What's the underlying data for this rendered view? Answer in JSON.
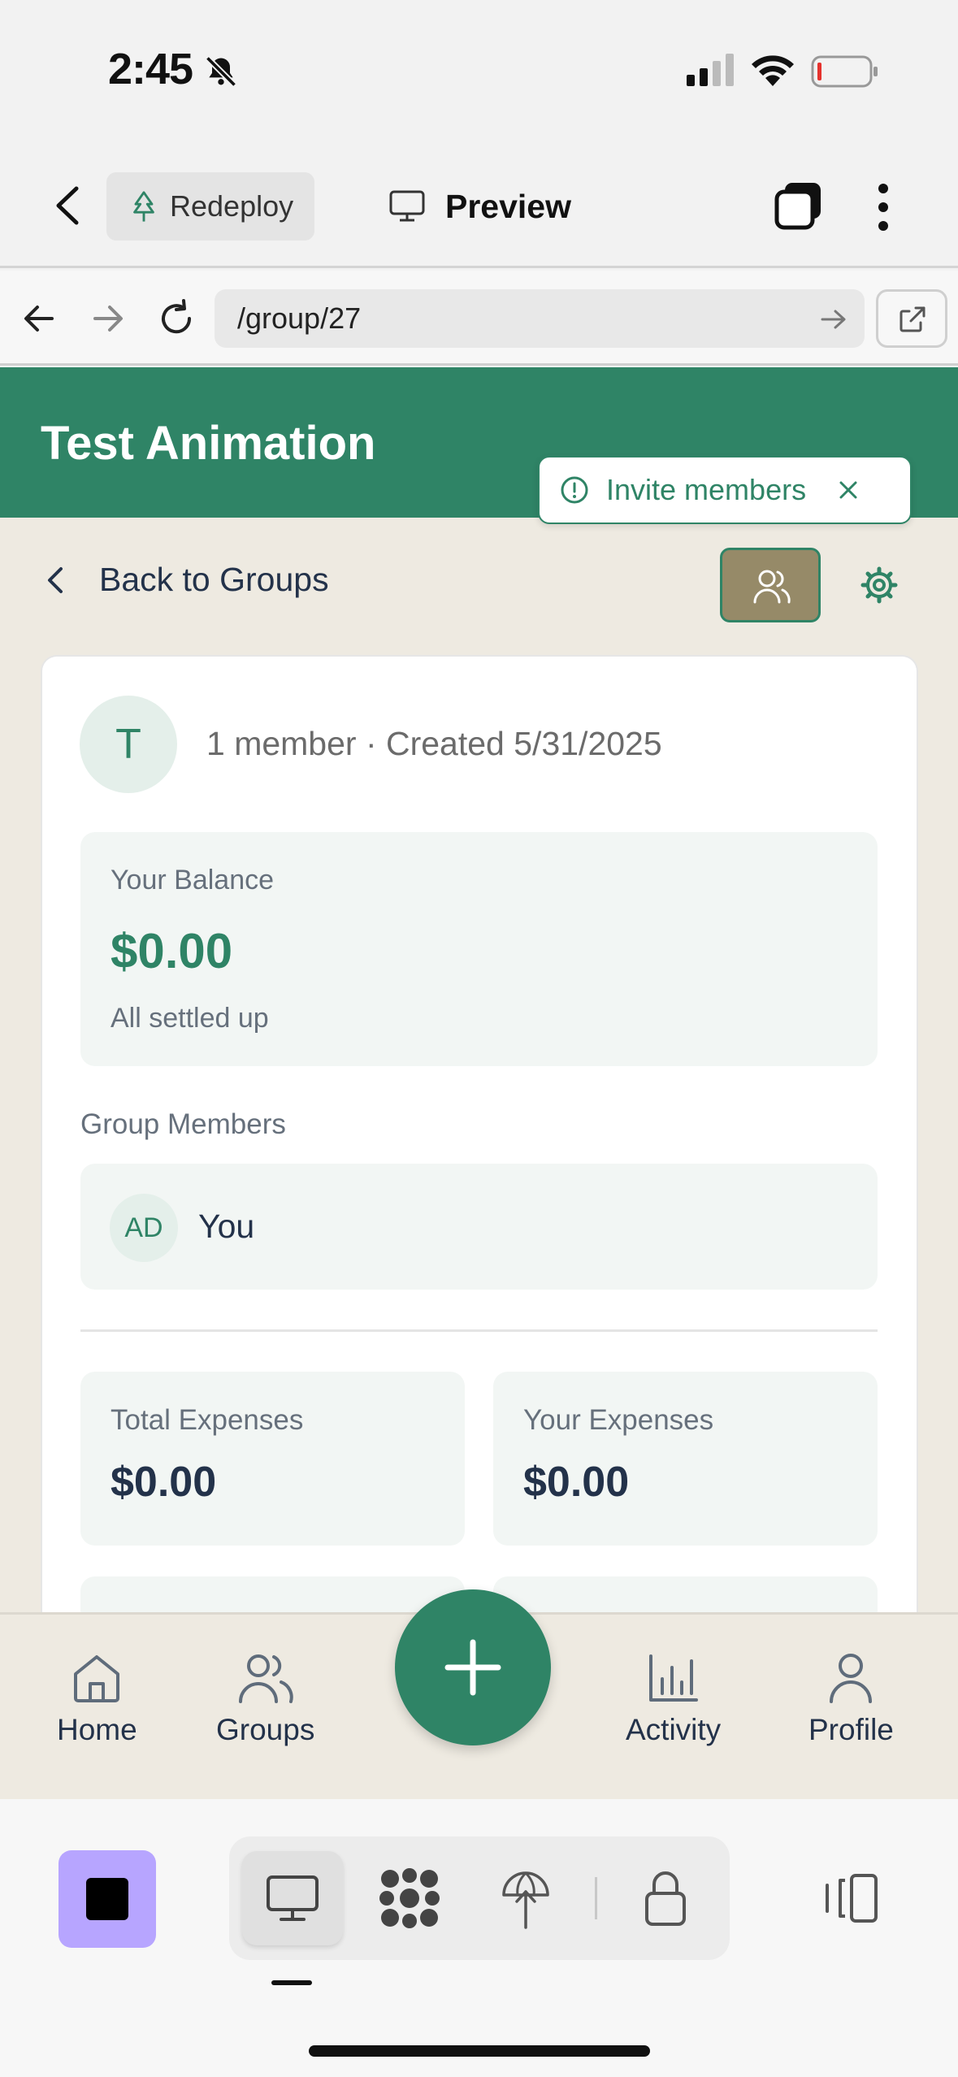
{
  "status_bar": {
    "time": "2:45",
    "icons": [
      "bell-slash-icon",
      "cellular-icon",
      "wifi-icon",
      "battery-low-icon"
    ]
  },
  "top_bar": {
    "redeploy_label": "Redeploy",
    "preview_label": "Preview"
  },
  "url_bar": {
    "url": "/group/27"
  },
  "app": {
    "title": "Test Animation",
    "toast": {
      "label": "Invite members"
    },
    "back_label": "Back to Groups",
    "group": {
      "initial": "T",
      "meta": "1 member · Created 5/31/2025",
      "balance_label": "Your Balance",
      "balance_value": "$0.00",
      "balance_status": "All settled up",
      "members_heading": "Group Members",
      "members": [
        {
          "initials": "AD",
          "name": "You"
        }
      ],
      "stats": [
        {
          "label": "Total Expenses",
          "value": "$0.00"
        },
        {
          "label": "Your Expenses",
          "value": "$0.00"
        }
      ]
    },
    "nav": [
      {
        "label": "Home",
        "icon": "home-icon"
      },
      {
        "label": "Groups",
        "icon": "users-icon"
      },
      {
        "label": "Activity",
        "icon": "bar-chart-icon"
      },
      {
        "label": "Profile",
        "icon": "user-icon"
      }
    ]
  },
  "colors": {
    "brand_green": "#2f8466",
    "background": "#eeeae1",
    "members_button": "#968a68",
    "stop_button": "#b7a5ff"
  }
}
